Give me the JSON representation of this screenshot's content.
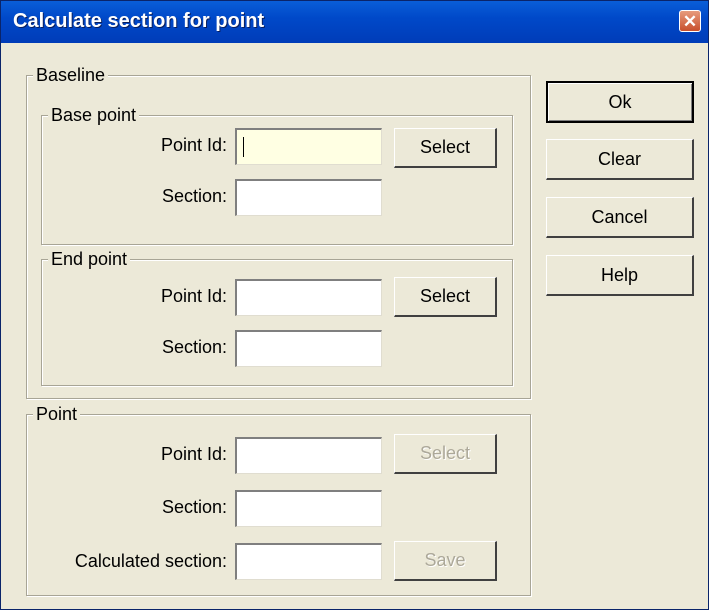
{
  "window": {
    "title": "Calculate section for point",
    "close_glyph": "✕"
  },
  "baseline": {
    "legend": "Baseline",
    "base_point": {
      "legend": "Base point",
      "point_id_label": "Point Id:",
      "point_id_value": "",
      "section_label": "Section:",
      "section_value": "",
      "select_label": "Select"
    },
    "end_point": {
      "legend": "End point",
      "point_id_label": "Point Id:",
      "point_id_value": "",
      "section_label": "Section:",
      "section_value": "",
      "select_label": "Select"
    }
  },
  "point": {
    "legend": "Point",
    "point_id_label": "Point Id:",
    "point_id_value": "",
    "section_label": "Section:",
    "section_value": "",
    "calculated_label": "Calculated section:",
    "calculated_value": "",
    "select_label": "Select",
    "save_label": "Save"
  },
  "actions": {
    "ok_label": "Ok",
    "clear_label": "Clear",
    "cancel_label": "Cancel",
    "help_label": "Help"
  }
}
